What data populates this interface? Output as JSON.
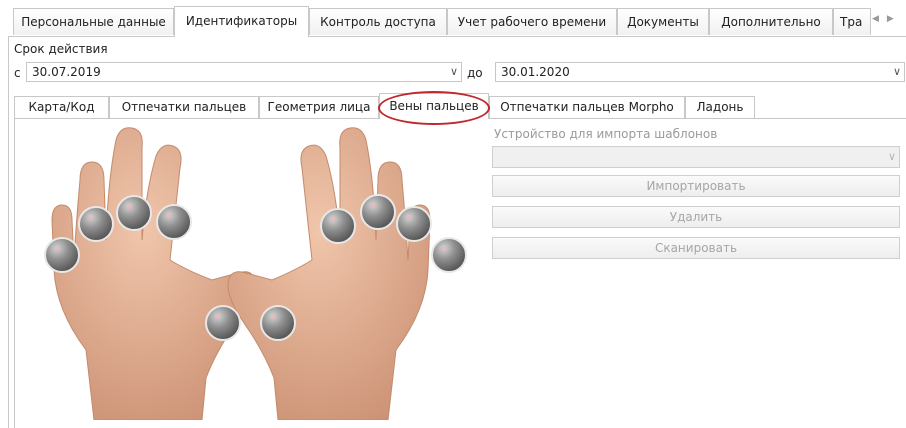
{
  "main_tabs": [
    {
      "label": "Персональные данные"
    },
    {
      "label": "Идентификаторы"
    },
    {
      "label": "Контроль доступа"
    },
    {
      "label": "Учет рабочего времени"
    },
    {
      "label": "Документы"
    },
    {
      "label": "Дополнительно"
    },
    {
      "label": "Тра"
    }
  ],
  "validity": {
    "title": "Срок действия",
    "from_label": "с",
    "from_value": "30.07.2019",
    "to_label": "до",
    "to_value": "30.01.2020"
  },
  "sub_tabs": [
    {
      "label": "Карта/Код"
    },
    {
      "label": "Отпечатки пальцев"
    },
    {
      "label": "Геометрия лица"
    },
    {
      "label": "Вены пальцев"
    },
    {
      "label": "Отпечатки пальцев Morpho"
    },
    {
      "label": "Ладонь"
    }
  ],
  "right_panel": {
    "device_label": "Устройство для импорта шаблонов",
    "device_value": "",
    "import_label": "Импортировать",
    "delete_label": "Удалить",
    "scan_label": "Сканировать"
  },
  "colors": {
    "skin": "#e7b79b",
    "finger_marker": "#7d7d7d",
    "highlight": "#c0282d"
  }
}
